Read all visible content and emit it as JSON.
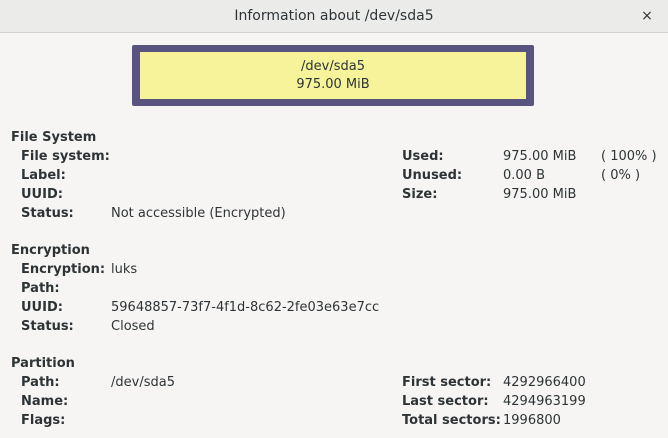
{
  "window": {
    "title": "Information about /dev/sda5",
    "close_icon": "×"
  },
  "partition_graphic": {
    "path": "/dev/sda5",
    "size": "975.00 MiB",
    "colors": {
      "border": "#59537f",
      "fill": "#f6f39b"
    }
  },
  "file_system": {
    "heading": "File System",
    "filesystem_label": "File system:",
    "filesystem_value": "",
    "label_label": "Label:",
    "label_value": "",
    "uuid_label": "UUID:",
    "uuid_value": "",
    "status_label": "Status:",
    "status_value": "Not accessible (Encrypted)",
    "used_label": "Used:",
    "used_value": "975.00 MiB",
    "used_pct": "( 100% )",
    "unused_label": "Unused:",
    "unused_value": "0.00 B",
    "unused_pct": "( 0% )",
    "size_label": "Size:",
    "size_value": "975.00 MiB"
  },
  "encryption": {
    "heading": "Encryption",
    "encryption_label": "Encryption:",
    "encryption_value": "luks",
    "path_label": "Path:",
    "path_value": "",
    "uuid_label": "UUID:",
    "uuid_value": "59648857-73f7-4f1d-8c62-2fe03e63e7cc",
    "status_label": "Status:",
    "status_value": "Closed"
  },
  "partition": {
    "heading": "Partition",
    "path_label": "Path:",
    "path_value": "/dev/sda5",
    "name_label": "Name:",
    "name_value": "",
    "flags_label": "Flags:",
    "flags_value": "",
    "first_sector_label": "First sector:",
    "first_sector_value": "4292966400",
    "last_sector_label": "Last sector:",
    "last_sector_value": "4294963199",
    "total_sectors_label": "Total sectors:",
    "total_sectors_value": "1996800"
  }
}
